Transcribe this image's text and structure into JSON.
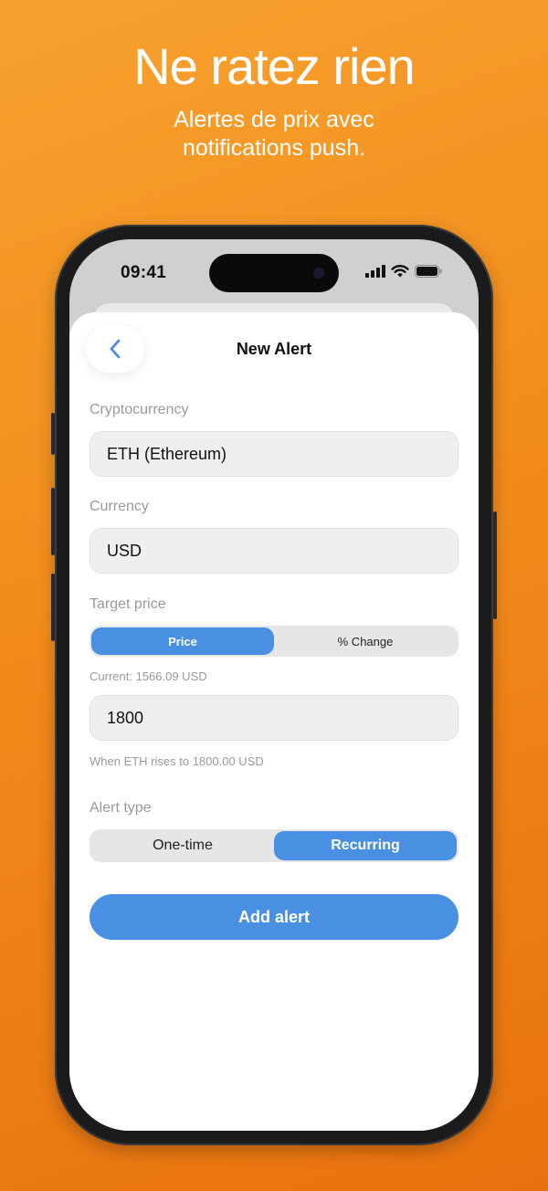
{
  "promo": {
    "headline": "Ne ratez rien",
    "subline": "Alertes de prix avec notifications push."
  },
  "status_bar": {
    "time": "09:41",
    "icons": [
      "cellular-signal-icon",
      "wifi-icon",
      "battery-icon"
    ]
  },
  "sheet": {
    "title": "New Alert",
    "back_icon": "chevron-left-icon"
  },
  "form": {
    "crypto_label": "Cryptocurrency",
    "crypto_value": "ETH (Ethereum)",
    "currency_label": "Currency",
    "currency_value": "USD",
    "target_label": "Target price",
    "target_modes": [
      "Price",
      "% Change"
    ],
    "target_mode_selected": "Price",
    "current_text": "Current: 1566.09 USD",
    "target_value": "1800",
    "target_hint": "When ETH rises to 1800.00 USD",
    "alert_type_label": "Alert type",
    "alert_types": [
      "One-time",
      "Recurring"
    ],
    "alert_type_selected": "Recurring",
    "submit_label": "Add alert"
  },
  "colors": {
    "accent": "#4a90e2",
    "background_gradient_start": "#f7a12e",
    "background_gradient_end": "#e8720f"
  }
}
